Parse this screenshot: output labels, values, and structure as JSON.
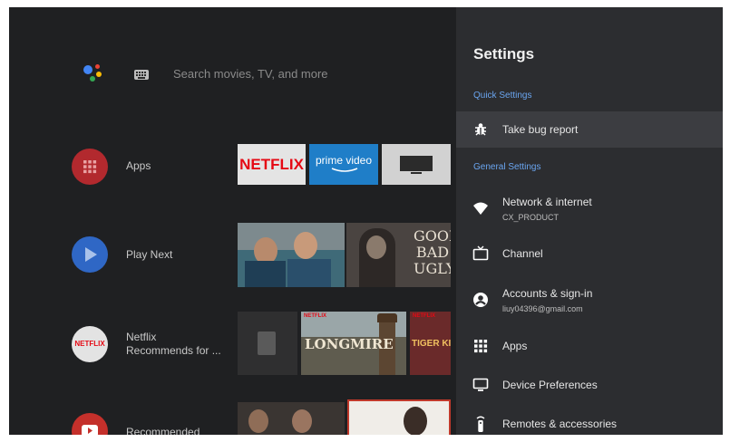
{
  "search": {
    "placeholder": "Search movies, TV, and more",
    "assistant_icon": "google-assistant-icon",
    "keyboard_icon": "keyboard-icon"
  },
  "rows": [
    {
      "label": "Apps",
      "icon": "apps-grid-icon",
      "color": "#b2292e"
    },
    {
      "label": "Play Next",
      "icon": "play-icon",
      "color": "#2f67c5"
    },
    {
      "label_line1": "Netflix",
      "label_line2": "Recommends for ...",
      "icon": "netflix-icon",
      "icon_text": "NETFLIX",
      "color": "#e3e3e3"
    },
    {
      "label": "Recommended",
      "icon": "youtube-icon",
      "color": "#c4302b"
    }
  ],
  "apps_row": {
    "tiles": [
      {
        "name": "netflix-app-tile",
        "text": "NETFLIX"
      },
      {
        "name": "prime-video-app-tile",
        "text": "prime video"
      },
      {
        "name": "tv-app-tile",
        "text": ""
      }
    ]
  },
  "play_next_row": {
    "tiles": [
      {
        "name": "movie-tile-1",
        "text": ""
      },
      {
        "name": "good-bad-ugly-tile",
        "line1": "GOOD",
        "line2": "BAD",
        "line3": "UGLY"
      }
    ]
  },
  "netflix_row": {
    "tiles": [
      {
        "name": "netflix-tile-1",
        "text": ""
      },
      {
        "name": "longmire-tile",
        "badge": "NETFLIX",
        "text": "LONGMIRE"
      },
      {
        "name": "tiger-king-tile",
        "badge": "NETFLIX",
        "text": "TIGER KING"
      }
    ]
  },
  "settings": {
    "title": "Settings",
    "quick_section": "Quick Settings",
    "general_section": "General Settings",
    "quick_items": [
      {
        "label": "Take bug report",
        "icon": "bug-icon",
        "selected": true
      }
    ],
    "general_items": [
      {
        "label": "Network & internet",
        "sub": "CX_PRODUCT",
        "icon": "wifi-icon"
      },
      {
        "label": "Channel",
        "icon": "tv-channel-icon"
      },
      {
        "label": "Accounts & sign-in",
        "sub": "liuy04396@gmail.com",
        "icon": "account-icon"
      },
      {
        "label": "Apps",
        "icon": "apps-grid-icon"
      },
      {
        "label": "Device Preferences",
        "icon": "monitor-icon"
      },
      {
        "label": "Remotes & accessories",
        "icon": "remote-icon"
      }
    ]
  },
  "colors": {
    "background": "#1f2022",
    "panel": "#2c2d30",
    "panel_selected": "#3c3d41",
    "section_accent": "#6aa5f0",
    "netflix_red": "#e50914",
    "prime_blue": "#1f7ec8"
  }
}
